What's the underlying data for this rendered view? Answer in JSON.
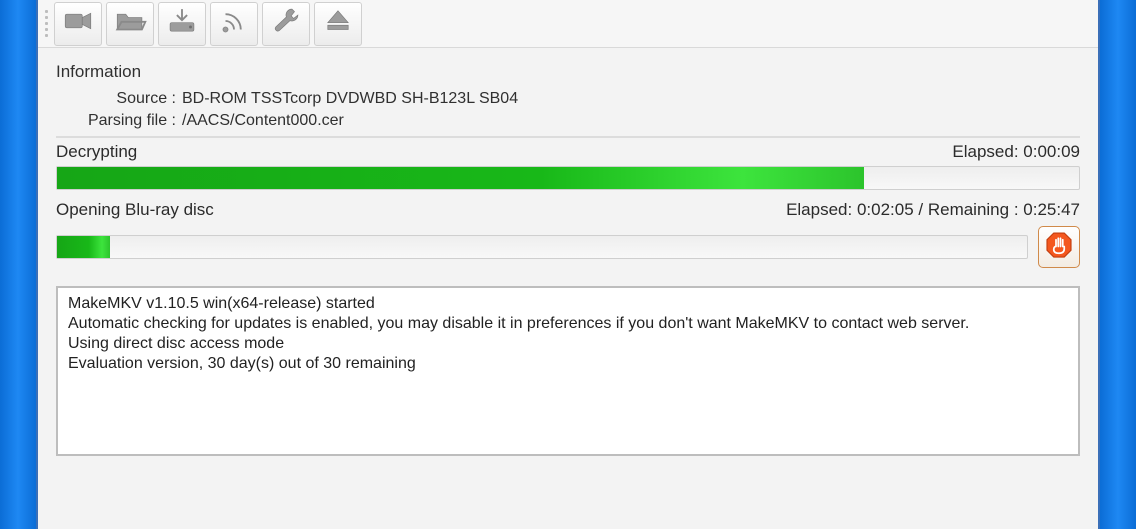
{
  "info": {
    "section_title": "Information",
    "source_label": "Source :",
    "source_value": "BD-ROM TSSTcorp DVDWBD SH-B123L SB04",
    "parsing_label": "Parsing file :",
    "parsing_value": "/AACS/Content000.cer"
  },
  "task1": {
    "name": "Decrypting",
    "elapsed_label": "Elapsed: 0:00:09",
    "percent_css": "79%"
  },
  "task2": {
    "name": "Opening Blu-ray disc",
    "timing_label": "Elapsed: 0:02:05 / Remaining : 0:25:47",
    "percent_css": "5.5%"
  },
  "log": {
    "l0": "MakeMKV v1.10.5 win(x64-release) started",
    "l1": "Automatic checking for updates is enabled, you may disable it in preferences if you don't want MakeMKV to contact web server.",
    "l2": "Using direct disc access mode",
    "l3": "Evaluation version, 30 day(s) out of 30 remaining"
  }
}
